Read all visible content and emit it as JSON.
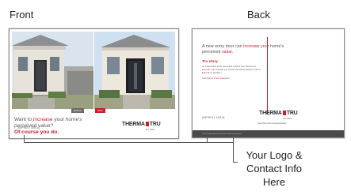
{
  "labels": {
    "front": "Front",
    "back": "Back",
    "callout": [
      "Your Logo &",
      "Contact Info",
      "Here"
    ]
  },
  "front_card": {
    "badge_before": "Before",
    "badge_after": "After",
    "headline_pre": "Want to ",
    "headline_highlight": "increase",
    "headline_post": " your home's perceived value?",
    "cta": "Of course you do.",
    "imprint_placeholder": "[IMPRINT AREA]",
    "logo_left": "THERMA",
    "logo_right": "TRU",
    "logo_sub": "DOORS"
  },
  "back_card": {
    "headline_pre": "A new entry door can ",
    "headline_highlight": "increase",
    "headline_mid": " your home's perceived ",
    "headline_highlight2": "value.",
    "subhead": "Tru story.",
    "body_pre": "An independent study shows that a stylish new Therma-Tru entry door can increase your home's perceived value by ",
    "body_hl1": "4.3%",
    "body_mid": " or ",
    "body_hl2": "$16,713",
    "body_post": " on average.*",
    "body_line2_pre": "Now that's a ",
    "body_line2_hl": "smart investment",
    "body_line2_post": ".",
    "imprint_placeholder": "[IMPRINT AREA]",
    "logo_left": "THERMA",
    "logo_right": "TRU",
    "logo_sub": "DOORS",
    "website": "www.thermatru.com/dreamdoor",
    "footer_fineprint": "*Source: independent perceived value study. Results may vary."
  },
  "colors": {
    "accent_red": "#c8202d",
    "stripe_gray": "#4a4a4a"
  }
}
